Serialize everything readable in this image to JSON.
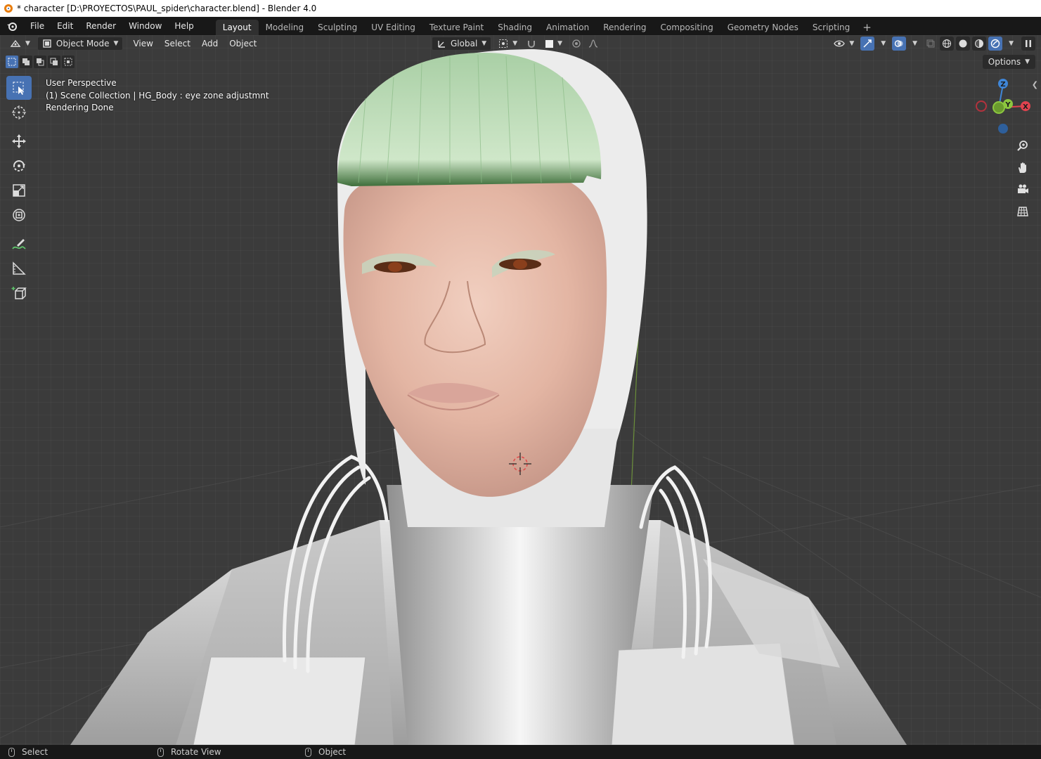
{
  "window": {
    "title": "* character [D:\\PROYECTOS\\PAUL_spider\\character.blend] - Blender 4.0"
  },
  "topbar": {
    "menus": [
      "File",
      "Edit",
      "Render",
      "Window",
      "Help"
    ],
    "workspaces": [
      "Layout",
      "Modeling",
      "Sculpting",
      "UV Editing",
      "Texture Paint",
      "Shading",
      "Animation",
      "Rendering",
      "Compositing",
      "Geometry Nodes",
      "Scripting"
    ],
    "active_workspace": "Layout",
    "add_tab": "+"
  },
  "viewport_header": {
    "mode": "Object Mode",
    "menus": [
      "View",
      "Select",
      "Add",
      "Object"
    ],
    "transform_orientation": "Global",
    "options_label": "Options"
  },
  "overlay_text": {
    "line1": "User Perspective",
    "line2": "(1) Scene Collection | HG_Body : eye zone adjustmnt",
    "line3": "Rendering Done"
  },
  "gizmo": {
    "x": "X",
    "y": "Y",
    "z": "Z",
    "x_color": "#e2434f",
    "y_color": "#8cc63f",
    "z_color": "#3f86d8"
  },
  "statusbar": {
    "select": "Select",
    "rotate": "Rotate View",
    "object": "Object"
  },
  "colors": {
    "accent": "#4772b3",
    "ui_bg": "#181818",
    "viewport_bg": "#3b3b3b"
  },
  "icons": {
    "toolbar": [
      "select-box-icon",
      "cursor-icon",
      "move-icon",
      "rotate-icon",
      "scale-icon",
      "transform-icon",
      "annotate-icon",
      "measure-icon",
      "add-cube-icon"
    ],
    "navigation": [
      "zoom-icon",
      "pan-hand-icon",
      "camera-icon",
      "grid-view-icon"
    ]
  }
}
